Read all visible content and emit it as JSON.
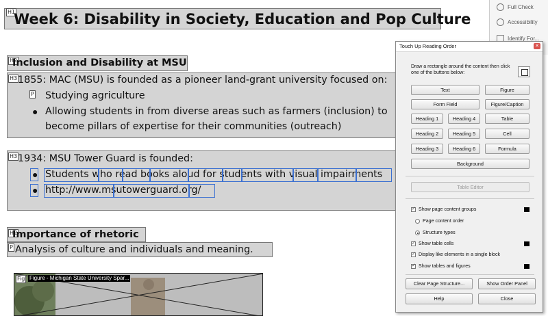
{
  "doc": {
    "h1_title": "Week 6: Disability in Society, Education and Pop Culture",
    "section1_heading": "Inclusion and Disability at MSU",
    "section1_line": "1855: MAC (MSU) is founded as a pioneer land-grant university focused on:",
    "section1_items": [
      "Studying agriculture",
      "Allowing students in from diverse areas such as farmers (inclusion) to",
      "become pillars of expertise for their communities (outreach)"
    ],
    "section2_line": "1934: MSU Tower Guard is founded:",
    "section2_items": [
      "Students who read books aloud for students with visual impairments",
      "http://www.msutowerguard.org/"
    ],
    "section3_heading": "Importance of rhetoric",
    "section3_line": "Analysis of culture and individuals and meaning.",
    "figure_caption": "Figure - Michigan State University Spar..."
  },
  "tags": {
    "h1": "H1",
    "h2": "H2",
    "h3": "H3",
    "p": "P",
    "fig": "Fig"
  },
  "side_panel": {
    "items": [
      "Full Check",
      "Accessibility",
      "Identify For..."
    ]
  },
  "dialog": {
    "title": "Touch Up Reading Order",
    "instruction": "Draw a rectangle around the content then click one of the buttons below:",
    "buttons": {
      "text": "Text",
      "figure": "Figure",
      "form_field": "Form Field",
      "figure_caption": "Figure/Caption",
      "heading1": "Heading 1",
      "heading2": "Heading 2",
      "heading3": "Heading 3",
      "heading4": "Heading 4",
      "heading5": "Heading 5",
      "heading6": "Heading 6",
      "table": "Table",
      "cell": "Cell",
      "formula": "Formula",
      "background": "Background",
      "table_editor": "Table Editor",
      "clear_structure": "Clear Page Structure...",
      "show_order_panel": "Show Order Panel",
      "help": "Help",
      "close": "Close"
    },
    "options": {
      "show_groups": "Show page content groups",
      "page_content_order": "Page content order",
      "structure_types": "Structure types",
      "show_table_cells": "Show table cells",
      "display_like": "Display like elements in a single block",
      "show_tables_figures": "Show tables and figures"
    },
    "option_state": {
      "show_groups": true,
      "view_mode": "Structure types",
      "show_table_cells": true,
      "display_like": true,
      "show_tables_figures": true
    }
  }
}
